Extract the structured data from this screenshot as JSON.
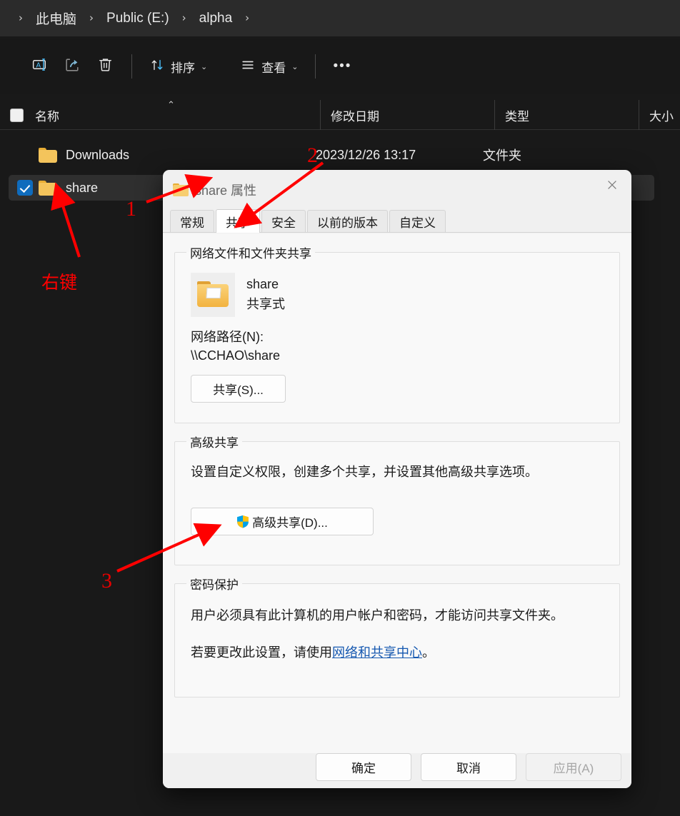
{
  "explorer": {
    "breadcrumb": {
      "leading_sep": "›",
      "items": [
        {
          "label": "此电脑",
          "name": "breadcrumb-this-pc"
        },
        {
          "label": "Public (E:)",
          "name": "breadcrumb-public-e"
        },
        {
          "label": "alpha",
          "name": "breadcrumb-alpha"
        }
      ],
      "separator": "›",
      "trailing_sep": "›"
    },
    "toolbar": {
      "rename_icon": "rename-icon",
      "share_icon": "share-icon",
      "delete_icon": "trash-icon",
      "sort_label": "排序",
      "sort_icon": "sort-arrows-icon",
      "view_label": "查看",
      "view_icon": "list-lines-icon",
      "chevron": "⌄",
      "more_label": "•••"
    },
    "columns": [
      {
        "label": "名称",
        "name": "column-header-name"
      },
      {
        "label": "修改日期",
        "name": "column-header-date-modified"
      },
      {
        "label": "类型",
        "name": "column-header-type"
      },
      {
        "label": "大小",
        "name": "column-header-size"
      }
    ],
    "sort_caret": "⌃",
    "rows": [
      {
        "name": "Downloads",
        "date": "2023/12/26 13:17",
        "type": "文件夹",
        "size": "",
        "selected": false
      },
      {
        "name": "share",
        "date": "",
        "type": "",
        "size": "",
        "selected": true
      }
    ]
  },
  "dialog": {
    "title": "share 属性",
    "folder_icon": "folder-icon",
    "close_icon": "close-icon",
    "tabs": [
      {
        "label": "常规",
        "active": false
      },
      {
        "label": "共享",
        "active": true
      },
      {
        "label": "安全",
        "active": false
      },
      {
        "label": "以前的版本",
        "active": false
      },
      {
        "label": "自定义",
        "active": false
      }
    ],
    "network_share": {
      "legend": "网络文件和文件夹共享",
      "folder_icon": "shared-folder-icon",
      "folder_name": "share",
      "share_state": "共享式",
      "network_path_label": "网络路径(N):",
      "network_path_value": "\\\\CCHAO\\share",
      "share_button": "共享(S)..."
    },
    "advanced_share": {
      "legend": "高级共享",
      "description": "设置自定义权限，创建多个共享，并设置其他高级共享选项。",
      "button_label": "高级共享(D)...",
      "button_icon": "uac-shield-icon"
    },
    "password_protection": {
      "legend": "密码保护",
      "line1": "用户必须具有此计算机的用户帐户和密码，才能访问共享文件夹。",
      "line2_prefix": "若要更改此设置，请使用",
      "line2_link": "网络和共享中心",
      "line2_suffix": "。"
    },
    "footer": {
      "ok": "确定",
      "cancel": "取消",
      "apply": "应用(A)"
    }
  },
  "annotations": {
    "step1": "1",
    "step2": "2",
    "step3": "3",
    "right_click_label": "右键",
    "color": "#ff0000"
  }
}
